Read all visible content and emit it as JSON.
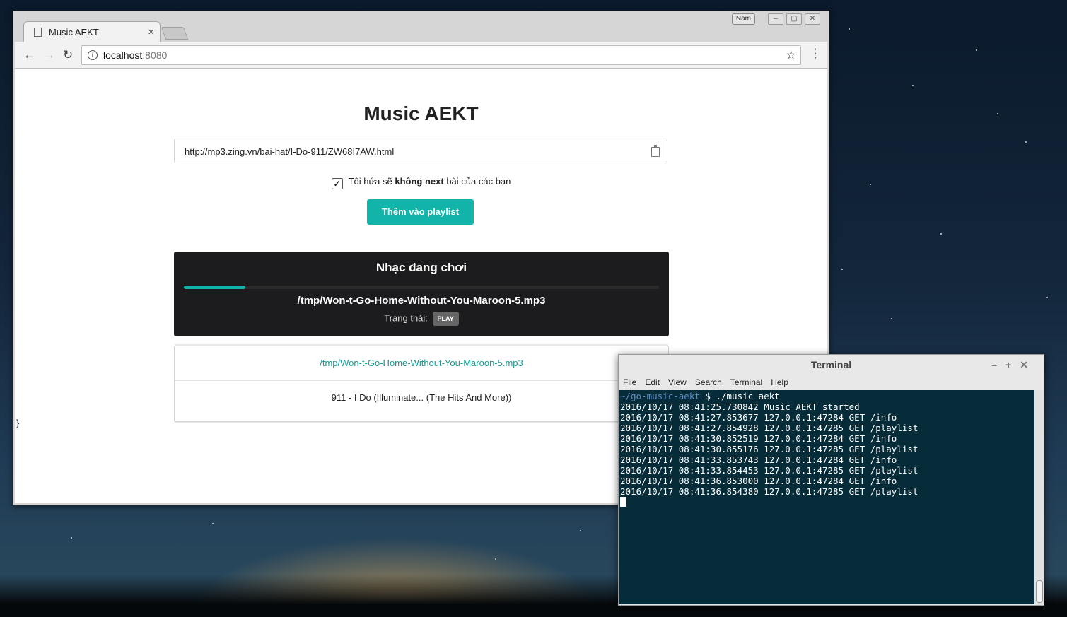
{
  "browser": {
    "user_badge": "Nam",
    "tab_title": "Music AEKT",
    "url_host": "localhost",
    "url_port": ":8080"
  },
  "app": {
    "title": "Music AEKT",
    "url_input_value": "http://mp3.zing.vn/bai-hat/I-Do-911/ZW68I7AW.html",
    "checkbox": {
      "prefix": "Tôi hứa sẽ ",
      "bold": "không next",
      "suffix": " bài của các bạn",
      "checked": true
    },
    "add_button": "Thêm vào playlist",
    "player": {
      "heading": "Nhạc đang chơi",
      "progress": 0.13,
      "track": "/tmp/Won-t-Go-Home-Without-You-Maroon-5.mp3",
      "status_label": "Trạng thái:",
      "status_value": "PLAY"
    },
    "playlist": [
      "/tmp/Won-t-Go-Home-Without-You-Maroon-5.mp3",
      "911 - I Do (Illuminate... (The Hits And More))"
    ],
    "stray_text": "}"
  },
  "terminal": {
    "title": "Terminal",
    "menu": [
      "File",
      "Edit",
      "View",
      "Search",
      "Terminal",
      "Help"
    ],
    "prompt_path": "~/go-music-aekt",
    "prompt_cmd": " $ ./music_aekt",
    "lines": [
      "2016/10/17 08:41:25.730842 Music AEKT started",
      "2016/10/17 08:41:27.853677 127.0.0.1:47284 GET /info",
      "2016/10/17 08:41:27.854928 127.0.0.1:47285 GET /playlist",
      "2016/10/17 08:41:30.852519 127.0.0.1:47284 GET /info",
      "2016/10/17 08:41:30.855176 127.0.0.1:47285 GET /playlist",
      "2016/10/17 08:41:33.853743 127.0.0.1:47284 GET /info",
      "2016/10/17 08:41:33.854453 127.0.0.1:47285 GET /playlist",
      "2016/10/17 08:41:36.853000 127.0.0.1:47284 GET /info",
      "2016/10/17 08:41:36.854380 127.0.0.1:47285 GET /playlist"
    ]
  },
  "colors": {
    "accent": "#12b3a8",
    "player_bg": "#1c1c1e",
    "terminal_bg": "#062c3a"
  }
}
